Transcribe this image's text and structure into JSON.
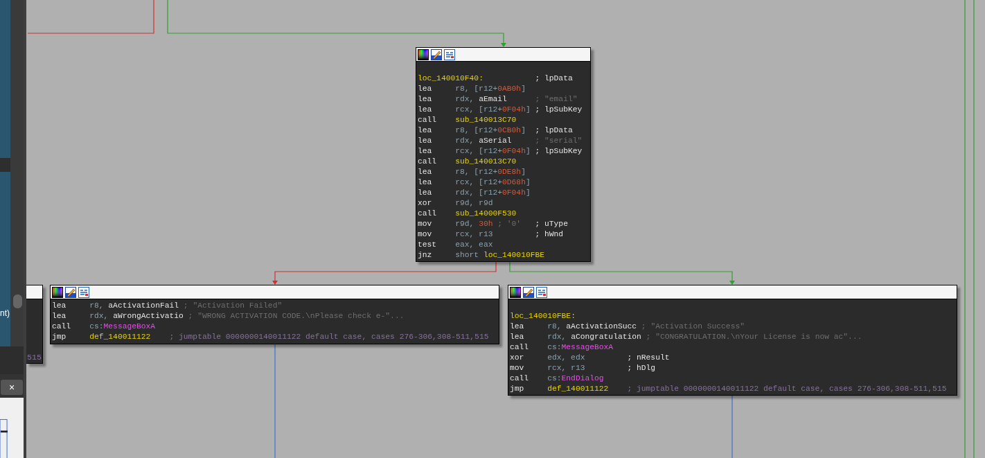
{
  "left_panel": {
    "list_text": "nt)",
    "close_button": "×"
  },
  "partial_node": {
    "text": "515"
  },
  "nodes": [
    {
      "lines": [
        {
          "label": "loc_140010F40:",
          "comment": {
            "text": "; lpData",
            "kind": "note"
          }
        },
        {
          "mnemonic": "lea",
          "operands": [
            {
              "text": "r8, [r12+",
              "kind": "reg"
            },
            {
              "text": "0AB0h",
              "kind": "num"
            },
            {
              "text": "]",
              "kind": "reg"
            }
          ]
        },
        {
          "mnemonic": "lea",
          "operands": [
            {
              "text": "rdx, ",
              "kind": "reg"
            },
            {
              "text": "aEmail",
              "kind": "name"
            }
          ],
          "comment": {
            "text": "; \"email\"",
            "kind": "str"
          }
        },
        {
          "mnemonic": "lea",
          "operands": [
            {
              "text": "rcx, [r12+",
              "kind": "reg"
            },
            {
              "text": "0F04h",
              "kind": "num"
            },
            {
              "text": "]",
              "kind": "reg"
            }
          ],
          "comment": {
            "text": "; lpSubKey",
            "kind": "note"
          }
        },
        {
          "mnemonic": "call",
          "operands": [
            {
              "text": "sub_140013C70",
              "kind": "label"
            }
          ]
        },
        {
          "mnemonic": "lea",
          "operands": [
            {
              "text": "r8, [r12+",
              "kind": "reg"
            },
            {
              "text": "0CB0h",
              "kind": "num"
            },
            {
              "text": "]",
              "kind": "reg"
            }
          ],
          "comment": {
            "text": "; lpData",
            "kind": "note"
          }
        },
        {
          "mnemonic": "lea",
          "operands": [
            {
              "text": "rdx, ",
              "kind": "reg"
            },
            {
              "text": "aSerial",
              "kind": "name"
            }
          ],
          "comment": {
            "text": "; \"serial\"",
            "kind": "str"
          }
        },
        {
          "mnemonic": "lea",
          "operands": [
            {
              "text": "rcx, [r12+",
              "kind": "reg"
            },
            {
              "text": "0F04h",
              "kind": "num"
            },
            {
              "text": "]",
              "kind": "reg"
            }
          ],
          "comment": {
            "text": "; lpSubKey",
            "kind": "note"
          }
        },
        {
          "mnemonic": "call",
          "operands": [
            {
              "text": "sub_140013C70",
              "kind": "label"
            }
          ]
        },
        {
          "mnemonic": "lea",
          "operands": [
            {
              "text": "r8, [r12+",
              "kind": "reg"
            },
            {
              "text": "0DE8h",
              "kind": "num"
            },
            {
              "text": "]",
              "kind": "reg"
            }
          ]
        },
        {
          "mnemonic": "lea",
          "operands": [
            {
              "text": "rcx, [r12+",
              "kind": "reg"
            },
            {
              "text": "0D68h",
              "kind": "num"
            },
            {
              "text": "]",
              "kind": "reg"
            }
          ]
        },
        {
          "mnemonic": "lea",
          "operands": [
            {
              "text": "rdx, [r12+",
              "kind": "reg"
            },
            {
              "text": "0F04h",
              "kind": "num"
            },
            {
              "text": "]",
              "kind": "reg"
            }
          ]
        },
        {
          "mnemonic": "xor",
          "operands": [
            {
              "text": "r9d, r9d",
              "kind": "reg"
            }
          ]
        },
        {
          "mnemonic": "call",
          "operands": [
            {
              "text": "sub_14000F530",
              "kind": "label"
            }
          ]
        },
        {
          "mnemonic": "mov",
          "operands": [
            {
              "text": "r9d, ",
              "kind": "reg"
            },
            {
              "text": "30h",
              "kind": "num"
            },
            {
              "text": " ; '0'",
              "kind": "str"
            }
          ],
          "comment": {
            "text": "; uType",
            "kind": "note"
          }
        },
        {
          "mnemonic": "mov",
          "operands": [
            {
              "text": "rcx, r13",
              "kind": "reg"
            }
          ],
          "comment": {
            "text": "; hWnd",
            "kind": "note"
          }
        },
        {
          "mnemonic": "test",
          "operands": [
            {
              "text": "eax, eax",
              "kind": "reg"
            }
          ]
        },
        {
          "mnemonic": "jnz",
          "operands": [
            {
              "text": "short ",
              "kind": "reg"
            },
            {
              "text": "loc_140010FBE",
              "kind": "label"
            }
          ]
        }
      ]
    },
    {
      "lines": [
        {
          "mnemonic": "lea",
          "operands": [
            {
              "text": "r8, ",
              "kind": "reg"
            },
            {
              "text": "aActivationFail",
              "kind": "name"
            }
          ],
          "comment": {
            "text": "; \"Activation Failed\"",
            "kind": "str"
          }
        },
        {
          "mnemonic": "lea",
          "operands": [
            {
              "text": "rdx, ",
              "kind": "reg"
            },
            {
              "text": "aWrongActivatio",
              "kind": "name"
            }
          ],
          "comment": {
            "text": "; \"WRONG ACTIVATION CODE.\\nPlease check e-\"...",
            "kind": "str"
          }
        },
        {
          "mnemonic": "call",
          "operands": [
            {
              "text": "cs:",
              "kind": "reg"
            },
            {
              "text": "MessageBoxA",
              "kind": "api"
            }
          ]
        },
        {
          "mnemonic": "jmp",
          "operands": [
            {
              "text": "def_140011122",
              "kind": "label"
            }
          ],
          "comment": {
            "text": "; jumptable 0000000140011122 default case, cases 276-306,308-511,515",
            "kind": "jt"
          }
        }
      ]
    },
    {
      "lines": [
        {
          "label": "loc_140010FBE:"
        },
        {
          "mnemonic": "lea",
          "operands": [
            {
              "text": "r8, ",
              "kind": "reg"
            },
            {
              "text": "aActivationSucc",
              "kind": "name"
            }
          ],
          "comment": {
            "text": "; \"Activation Success\"",
            "kind": "str"
          }
        },
        {
          "mnemonic": "lea",
          "operands": [
            {
              "text": "rdx, ",
              "kind": "reg"
            },
            {
              "text": "aCongratulation",
              "kind": "name"
            }
          ],
          "comment": {
            "text": "; \"CONGRATULATION.\\nYour License is now ac\"...",
            "kind": "str"
          }
        },
        {
          "mnemonic": "call",
          "operands": [
            {
              "text": "cs:",
              "kind": "reg"
            },
            {
              "text": "MessageBoxA",
              "kind": "api"
            }
          ]
        },
        {
          "mnemonic": "xor",
          "operands": [
            {
              "text": "edx, edx",
              "kind": "reg"
            }
          ],
          "comment": {
            "text": "; nResult",
            "kind": "note"
          }
        },
        {
          "mnemonic": "mov",
          "operands": [
            {
              "text": "rcx, r13",
              "kind": "reg"
            }
          ],
          "comment": {
            "text": "; hDlg",
            "kind": "note"
          }
        },
        {
          "mnemonic": "call",
          "operands": [
            {
              "text": "cs:",
              "kind": "reg"
            },
            {
              "text": "EndDialog",
              "kind": "api"
            }
          ]
        },
        {
          "mnemonic": "jmp",
          "operands": [
            {
              "text": "def_140011122",
              "kind": "label"
            }
          ],
          "comment": {
            "text": "; jumptable 0000000140011122 default case, cases 276-306,308-511,515",
            "kind": "jt"
          }
        }
      ]
    }
  ]
}
